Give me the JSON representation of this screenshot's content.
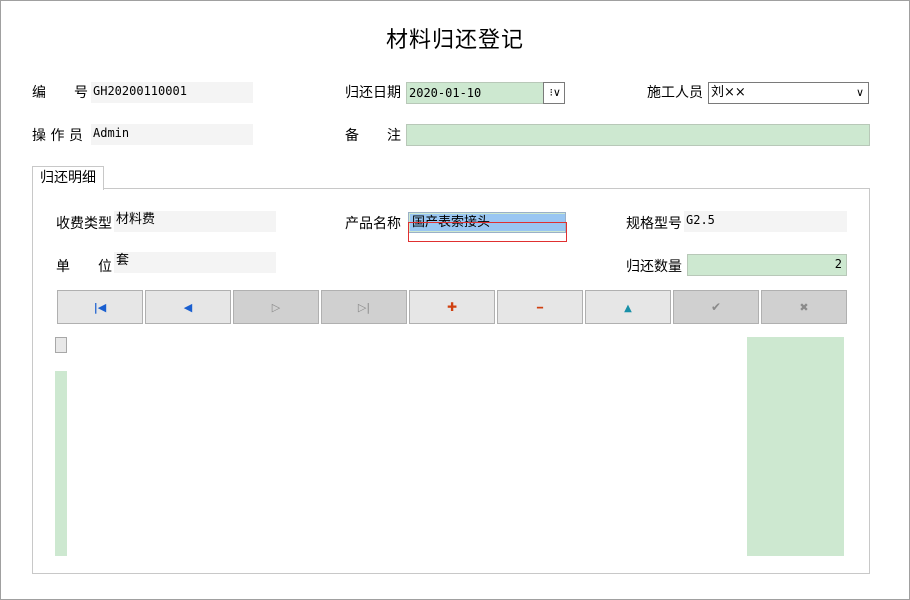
{
  "title": "材料归还登记",
  "header": {
    "code_label": "编　　号",
    "code_value": "GH20200110001",
    "return_date_label": "归还日期",
    "return_date_value": "2020-01-10",
    "worker_label": "施工人员",
    "worker_value": "刘××",
    "operator_label": "操 作 员",
    "operator_value": "Admin",
    "remark_label": "备　　注",
    "remark_value": ""
  },
  "tab": {
    "label": "归还明细"
  },
  "detail": {
    "fee_type_label": "收费类型",
    "fee_type_value": "材料费",
    "product_label": "产品名称",
    "product_value": "国产表索接头",
    "spec_label": "规格型号",
    "spec_value": "G2.5",
    "unit_label": "单　　位",
    "unit_value": "套",
    "qty_label": "归还数量",
    "qty_value": "2"
  },
  "toolbar": {
    "buttons": [
      {
        "name": "first-record",
        "glyph": "|◀",
        "color": "#1a5fd0"
      },
      {
        "name": "prev-record",
        "glyph": "◀",
        "color": "#1a5fd0"
      },
      {
        "name": "next-record",
        "glyph": "▷",
        "color": "#8a8a8a"
      },
      {
        "name": "last-record",
        "glyph": "▷|",
        "color": "#8a8a8a"
      },
      {
        "name": "add-record",
        "glyph": "✚",
        "color": "#d04010"
      },
      {
        "name": "delete-record",
        "glyph": "━",
        "color": "#d04010"
      },
      {
        "name": "edit-record",
        "glyph": "▲",
        "color": "#1890a8"
      },
      {
        "name": "post-record",
        "glyph": "✔",
        "color": "#8a8a8a"
      },
      {
        "name": "cancel-record",
        "glyph": "✖",
        "color": "#8a8a8a"
      }
    ]
  },
  "colors": {
    "field_green": "#cde8d0",
    "selection_blue": "#99c6f2",
    "focus_red": "#e03030"
  }
}
